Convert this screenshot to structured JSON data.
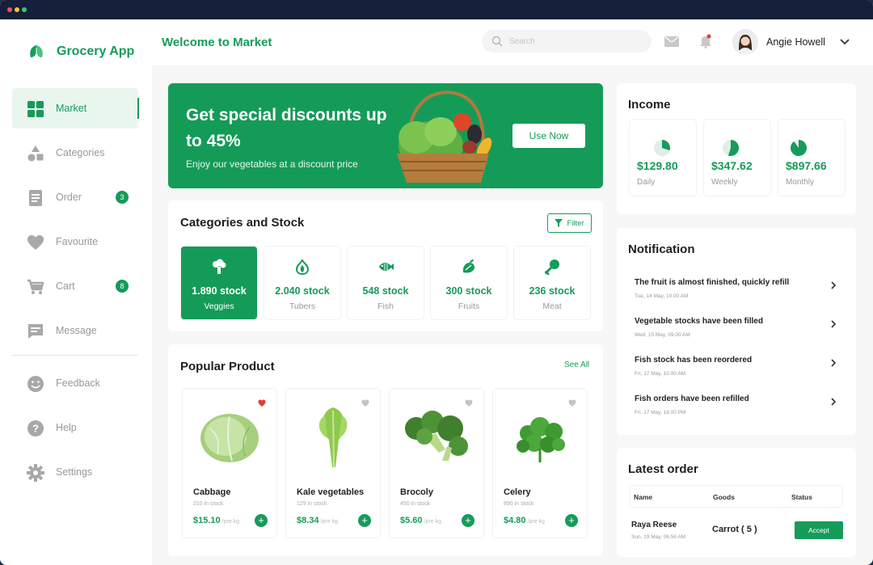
{
  "app": {
    "name": "Grocery App"
  },
  "sidebar": {
    "items": [
      {
        "label": "Market"
      },
      {
        "label": "Categories"
      },
      {
        "label": "Order",
        "badge": "3"
      },
      {
        "label": "Favourite"
      },
      {
        "label": "Cart",
        "badge": "8"
      },
      {
        "label": "Message"
      },
      {
        "label": "Feedback"
      },
      {
        "label": "Help"
      },
      {
        "label": "Settings"
      }
    ]
  },
  "header": {
    "title": "Welcome to Market",
    "search_placeholder": "Search",
    "user_name": "Angie Howell"
  },
  "banner": {
    "title": "Get special discounts up to 45%",
    "subtitle": "Enjoy our vegetables at a discount price",
    "button": "Use Now"
  },
  "categories": {
    "title": "Categories and Stock",
    "filter_label": "Filter",
    "items": [
      {
        "value": "1.890 stock",
        "label": "Veggies",
        "icon": "veggies-icon"
      },
      {
        "value": "2.040 stock",
        "label": "Tubers",
        "icon": "onion-icon"
      },
      {
        "value": "548 stock",
        "label": "Fish",
        "icon": "fish-icon"
      },
      {
        "value": "300 stock",
        "label": "Fruits",
        "icon": "fruit-icon"
      },
      {
        "value": "236 stock",
        "label": "Meat",
        "icon": "drumstick-icon"
      }
    ]
  },
  "products": {
    "title": "Popular Product",
    "see_all": "See All",
    "items": [
      {
        "name": "Cabbage",
        "stock": "210 in stock",
        "price": "$15.10",
        "unit": "/pre kg",
        "favorite": true
      },
      {
        "name": "Kale vegetables",
        "stock": "129 in stock",
        "price": "$8.34",
        "unit": "/pre kg",
        "favorite": false
      },
      {
        "name": "Brocoly",
        "stock": "450 in stock",
        "price": "$5.60",
        "unit": "/pre kg",
        "favorite": false
      },
      {
        "name": "Celery",
        "stock": "890 in stock",
        "price": "$4.80",
        "unit": "/pre kg",
        "favorite": false
      }
    ]
  },
  "income": {
    "title": "Income",
    "items": [
      {
        "value": "$129.80",
        "label": "Daily",
        "fraction": 0.3
      },
      {
        "value": "$347.62",
        "label": "Weekly",
        "fraction": 0.55
      },
      {
        "value": "$897.66",
        "label": "Monthly",
        "fraction": 0.9
      }
    ]
  },
  "notifications": {
    "title": "Notification",
    "items": [
      {
        "text": "The fruit is almost finished, quickly refill",
        "time": "Tue, 14 May, 10.00 AM"
      },
      {
        "text": "Vegetable stocks have been filled",
        "time": "Wed, 15 May, 09.00 AM"
      },
      {
        "text": "Fish stock has been reordered",
        "time": "Fri, 17 May, 10.00 AM"
      },
      {
        "text": "Fish orders have been refilled",
        "time": "Fri, 17 May, 18.00 PM"
      }
    ]
  },
  "latest_order": {
    "title": "Latest order",
    "columns": [
      "Name",
      "Goods",
      "Status"
    ],
    "row": {
      "name": "Raya Reese",
      "time": "Sun, 19 May, 06.56 AM",
      "goods": "Carrot ( 5 )",
      "action": "Accept"
    }
  },
  "colors": {
    "accent": "#169b5a",
    "accent_light": "#e8f6ee",
    "favorite": "#e53935"
  }
}
